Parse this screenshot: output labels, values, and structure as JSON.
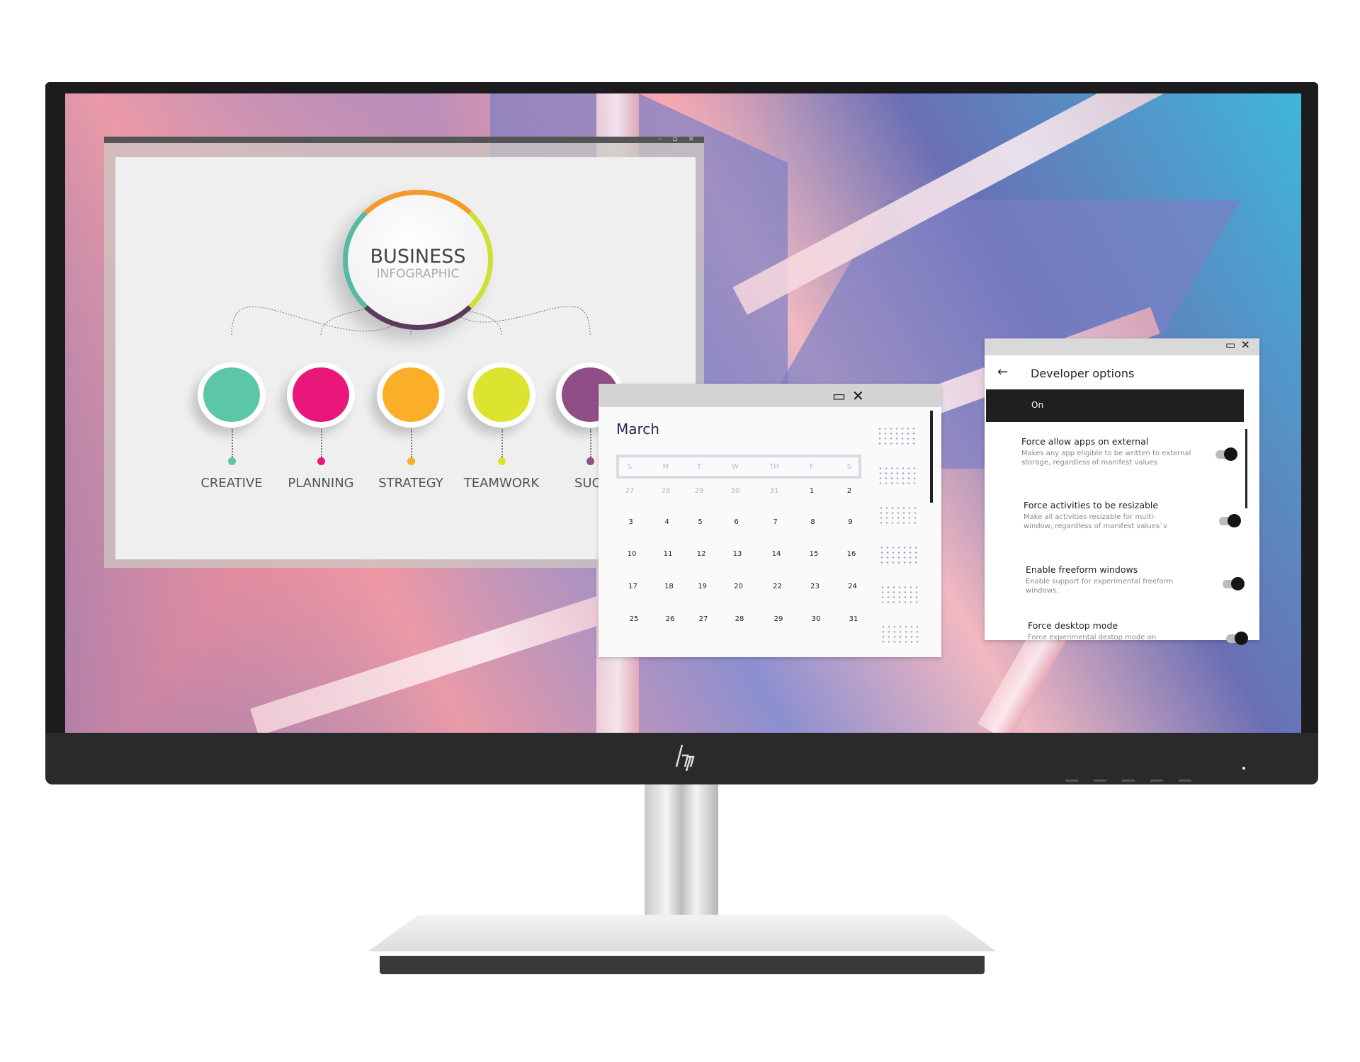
{
  "brand": {
    "logo": "hp"
  },
  "infographic_window": {
    "controls": [
      "–",
      "▫",
      "×"
    ],
    "title_line1": "BUSINESS",
    "title_line2": "INFOGRAPHIC",
    "nodes": [
      {
        "label": "CREATIVE",
        "color": "#5cc6a8"
      },
      {
        "label": "PLANNING",
        "color": "#e9177a"
      },
      {
        "label": "STRATEGY",
        "color": "#fbae28"
      },
      {
        "label": "TEAMWORK",
        "color": "#dde42f"
      },
      {
        "label": "SUCC",
        "color": "#8f4f86"
      }
    ]
  },
  "calendar": {
    "month": "March",
    "weekdays": [
      "S",
      "M",
      "T",
      "W",
      "TH",
      "F",
      "S"
    ],
    "weeks": [
      [
        "27",
        "28",
        "29",
        "30",
        "31",
        "1",
        "2"
      ],
      [
        "3",
        "4",
        "5",
        "6",
        "7",
        "8",
        "9"
      ],
      [
        "10",
        "11",
        "12",
        "13",
        "14",
        "15",
        "16"
      ],
      [
        "17",
        "18",
        "19",
        "20",
        "22",
        "23",
        "24"
      ],
      [
        "25",
        "26",
        "27",
        "28",
        "29",
        "30",
        "31"
      ]
    ],
    "muted_first_week_count": 5
  },
  "developer_options": {
    "title": "Developer options",
    "master_state": "On",
    "items": [
      {
        "title": "Force allow apps on external",
        "desc": "Makes any app eligible to be written to external storage, regardless of manifest values",
        "enabled": true
      },
      {
        "title": "Force activities to be resizable",
        "desc": "Make all activities resizable for multi-window, regardless of manifest values`v",
        "enabled": true
      },
      {
        "title": "Enable freeform windows",
        "desc": "Enable support for experimental freeform windows.",
        "enabled": true
      },
      {
        "title": "Force desktop mode",
        "desc": "Force experimental destop mode on",
        "enabled": true
      }
    ]
  }
}
